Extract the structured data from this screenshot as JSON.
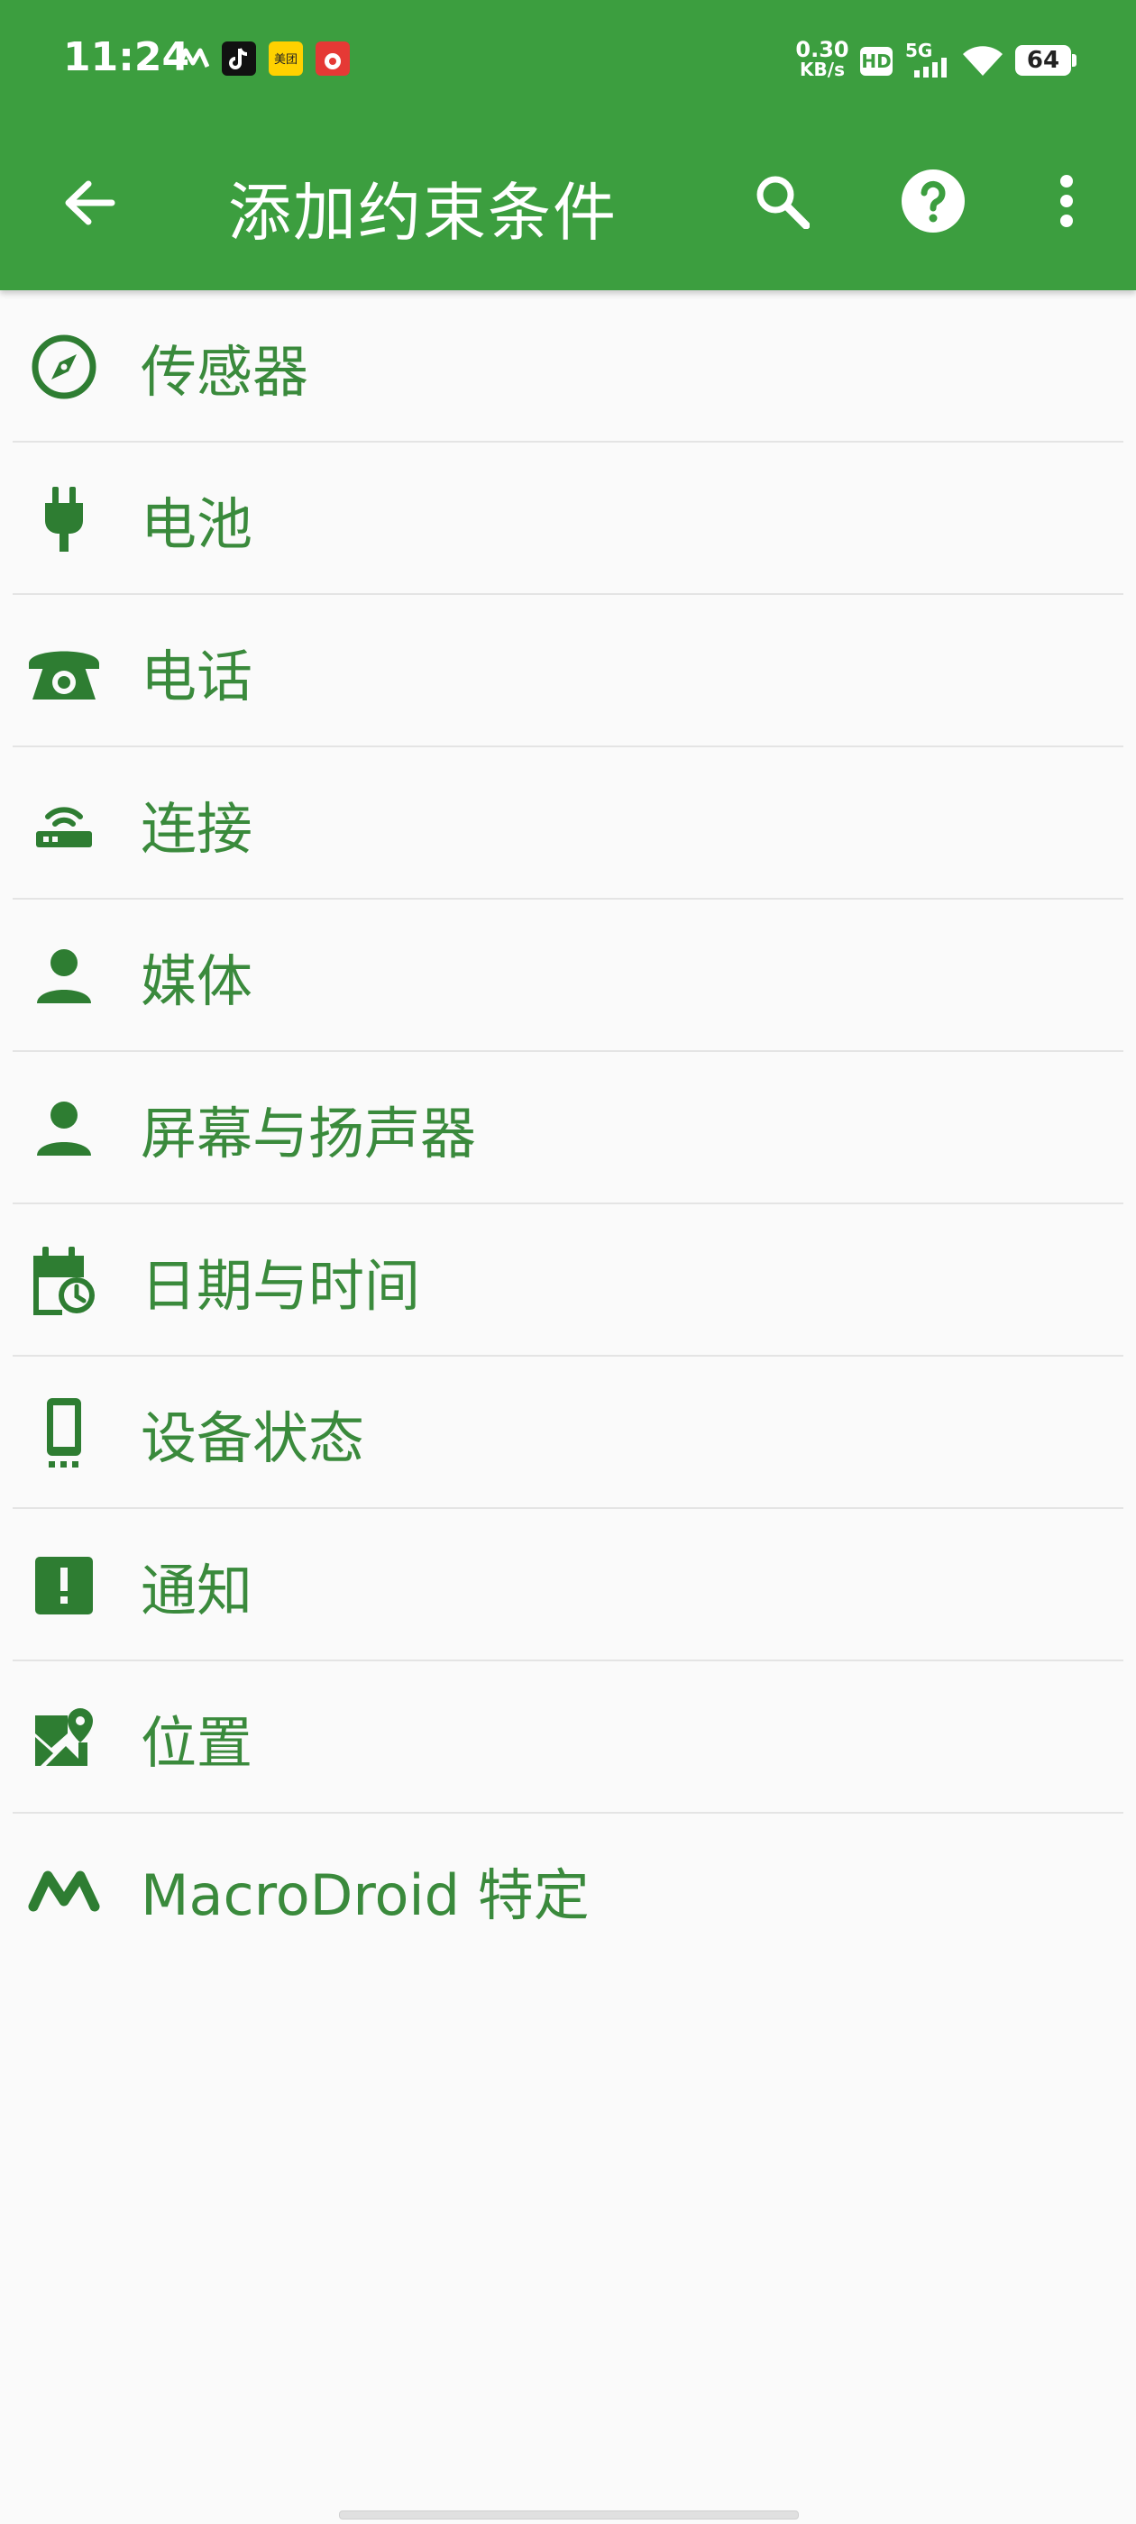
{
  "status_bar": {
    "time": "11:24",
    "network_speed_value": "0.30",
    "network_speed_unit": "KB/s",
    "hd_badge": "HD",
    "signal_label": "5G",
    "battery": "64",
    "notification_icons": [
      "macrodroid-icon",
      "tiktok-icon",
      "meituan-icon",
      "app-icon"
    ],
    "meituan_label": "美团"
  },
  "toolbar": {
    "title": "添加约束条件",
    "back_icon": "arrow-left-icon",
    "search_icon": "search-icon",
    "help_icon": "help-icon",
    "more_icon": "more-vert-icon"
  },
  "categories": [
    {
      "label": "传感器",
      "icon": "compass-icon"
    },
    {
      "label": "电池",
      "icon": "plug-icon"
    },
    {
      "label": "电话",
      "icon": "telephone-icon"
    },
    {
      "label": "连接",
      "icon": "router-icon"
    },
    {
      "label": "媒体",
      "icon": "person-icon"
    },
    {
      "label": "屏幕与扬声器",
      "icon": "person-icon"
    },
    {
      "label": "日期与时间",
      "icon": "calendar-clock-icon"
    },
    {
      "label": "设备状态",
      "icon": "phone-device-icon"
    },
    {
      "label": "通知",
      "icon": "alert-box-icon"
    },
    {
      "label": "位置",
      "icon": "map-marker-icon"
    },
    {
      "label": "MacroDroid 特定",
      "icon": "macrodroid-logo-icon"
    }
  ],
  "colors": {
    "primary": "#3c9e3f",
    "icon_green": "#2e7d32",
    "text_green": "#3a8a3c",
    "background": "#fafafa"
  }
}
